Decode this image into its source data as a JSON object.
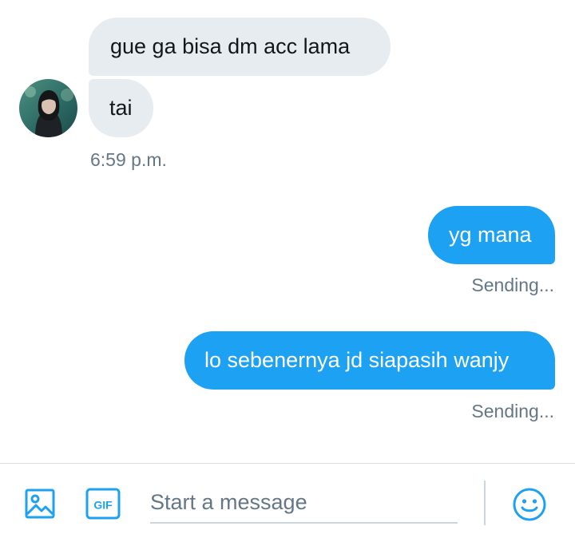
{
  "conversation": {
    "messages": [
      {
        "direction": "incoming",
        "text": "gue ga bisa dm acc lama"
      },
      {
        "direction": "incoming",
        "text": "tai"
      },
      {
        "direction": "outgoing",
        "text": "yg mana",
        "status": "Sending..."
      },
      {
        "direction": "outgoing",
        "text": "lo sebenernya jd siapasih wanjy",
        "status": "Sending..."
      }
    ],
    "incoming_timestamp": "6:59 p.m."
  },
  "composer": {
    "placeholder": "Start a message",
    "value": "",
    "gif_label": "GIF",
    "icons": [
      "image-icon",
      "gif-icon",
      "emoji-icon"
    ]
  },
  "colors": {
    "accent": "#1da1f2",
    "incoming_bubble": "#e6ecf0",
    "secondary_text": "#657786"
  }
}
